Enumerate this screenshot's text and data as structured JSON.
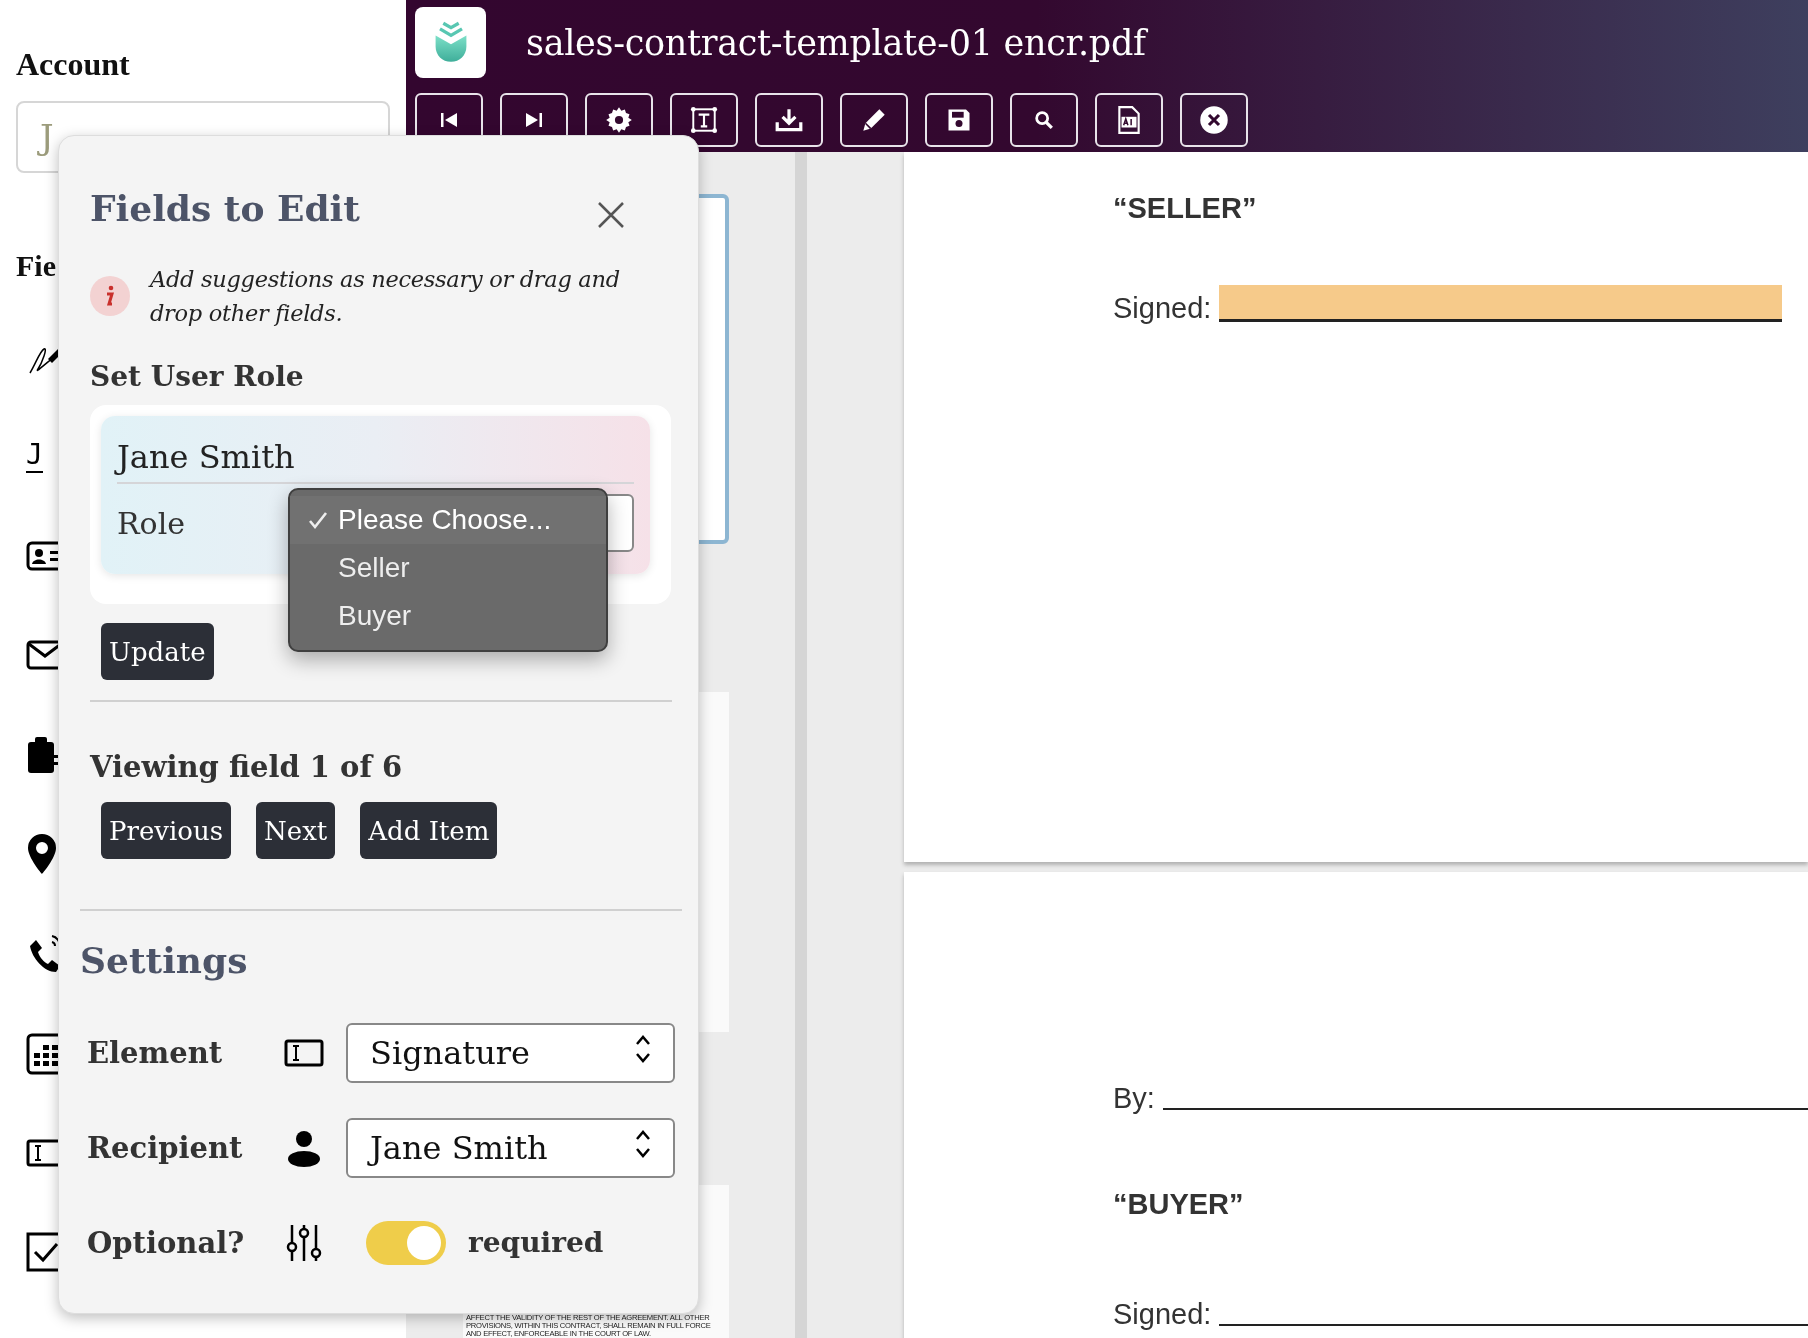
{
  "sidebar": {
    "account_label": "Account",
    "account_field": {
      "value": "J"
    },
    "fields_heading": "Fie",
    "field_tools": [
      {
        "kind": "signature"
      },
      {
        "kind": "initials",
        "text": "J"
      },
      {
        "kind": "id-card"
      },
      {
        "kind": "envelope"
      },
      {
        "kind": "clipboard"
      },
      {
        "kind": "map-pin"
      },
      {
        "kind": "phone"
      },
      {
        "kind": "calendar"
      },
      {
        "kind": "text-field"
      },
      {
        "kind": "checkbox"
      }
    ]
  },
  "header": {
    "title": "sales-contract-template-01 encr.pdf",
    "toolbar": [
      {
        "kind": "first-page"
      },
      {
        "kind": "last-page"
      },
      {
        "kind": "settings"
      },
      {
        "kind": "text-box"
      },
      {
        "kind": "download"
      },
      {
        "kind": "pen"
      },
      {
        "kind": "save"
      },
      {
        "kind": "search"
      },
      {
        "kind": "ai-file"
      },
      {
        "kind": "close"
      }
    ]
  },
  "thumbnails": [
    {
      "selected": true
    },
    {
      "selected": false
    },
    {
      "selected": false,
      "text": "AFFECT THE VALIDITY OF THE REST OF THE AGREEMENT. ALL OTHER PROVISIONS, WITHIN THIS CONTRACT, SHALL REMAIN IN FULL FORCE AND EFFECT, ENFORCEABLE IN THE COURT OF LAW."
    }
  ],
  "document": {
    "pages": [
      {
        "blocks": [
          {
            "kind": "heading",
            "text": "“SELLER”"
          },
          {
            "kind": "line",
            "label": "Signed:",
            "highlighted": true
          }
        ]
      },
      {
        "blocks": [
          {
            "kind": "line",
            "label": "By:",
            "highlighted": false
          },
          {
            "kind": "heading",
            "text": "“BUYER”"
          },
          {
            "kind": "line",
            "label": "Signed:",
            "highlighted": false
          }
        ]
      }
    ]
  },
  "dialog": {
    "title": "Fields to Edit",
    "info": "Add suggestions as necessary or drag and drop other fields.",
    "role_section": {
      "heading": "Set User Role",
      "name": "Jane Smith",
      "role_label": "Role",
      "update_button": "Update",
      "dropdown": [
        {
          "label": "Please Choose...",
          "selected": true
        },
        {
          "label": "Seller",
          "selected": false
        },
        {
          "label": "Buyer",
          "selected": false
        }
      ]
    },
    "viewing": "Viewing field 1 of 6",
    "nav_buttons": [
      "Previous",
      "Next",
      "Add Item"
    ],
    "settings": {
      "heading": "Settings",
      "rows": [
        {
          "kind": "select",
          "label": "Element",
          "icon": {
            "kind": "text-field"
          },
          "value": "Signature"
        },
        {
          "kind": "select",
          "label": "Recipient",
          "icon": {
            "kind": "person"
          },
          "value": "Jane Smith"
        },
        {
          "kind": "toggle",
          "label": "Optional?",
          "icon": {
            "kind": "sliders"
          },
          "on": true,
          "state_text": "required"
        }
      ]
    }
  }
}
